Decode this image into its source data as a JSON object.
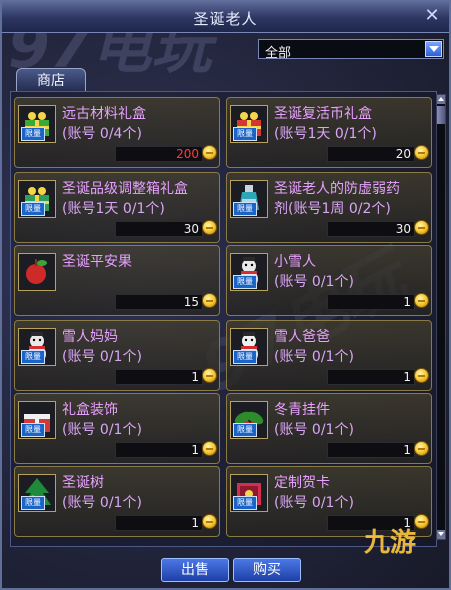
{
  "window": {
    "title": "圣诞老人",
    "close_label": "✕"
  },
  "filter": {
    "selected": "全部"
  },
  "tabs": [
    {
      "label": "商店"
    }
  ],
  "items": [
    {
      "name": "远古材料礼盒",
      "limit": "(账号 0/4个)",
      "price": "200",
      "price_red": true,
      "limited": true,
      "icon": "gift-box-icon",
      "color": "#3aa83a"
    },
    {
      "name": "圣诞复活币礼盒",
      "limit": "(账号1天 0/1个)",
      "price": "20",
      "price_red": false,
      "limited": true,
      "icon": "gift-box-icon",
      "color": "#d23636"
    },
    {
      "name": "圣诞品级调整箱礼盒",
      "limit": "(账号1天 0/1个)",
      "price": "30",
      "price_red": false,
      "limited": true,
      "icon": "gift-box-icon",
      "color": "#2fa05c"
    },
    {
      "name": "圣诞老人的防虚弱药",
      "limit": "剂(账号1周 0/2个)",
      "price": "30",
      "price_red": false,
      "limited": true,
      "icon": "potion-icon",
      "color": "#2fa6b8"
    },
    {
      "name": "圣诞平安果",
      "limit": "",
      "price": "15",
      "price_red": false,
      "limited": false,
      "icon": "apple-icon",
      "color": "#cf2a2a"
    },
    {
      "name": "小雪人",
      "limit": "(账号 0/1个)",
      "price": "1",
      "price_red": false,
      "limited": true,
      "icon": "snowman-icon",
      "color": "#e8e8e8"
    },
    {
      "name": "雪人妈妈",
      "limit": "(账号 0/1个)",
      "price": "1",
      "price_red": false,
      "limited": true,
      "icon": "snowman-icon",
      "color": "#e8e8e8"
    },
    {
      "name": "雪人爸爸",
      "limit": "(账号 0/1个)",
      "price": "1",
      "price_red": false,
      "limited": true,
      "icon": "snowman-icon",
      "color": "#f0f0f0"
    },
    {
      "name": "礼盒装饰",
      "limit": "(账号 0/1个)",
      "price": "1",
      "price_red": false,
      "limited": true,
      "icon": "gift-decoration-icon",
      "color": "#cf3a3a"
    },
    {
      "name": "冬青挂件",
      "limit": "(账号 0/1个)",
      "price": "1",
      "price_red": false,
      "limited": true,
      "icon": "holly-icon",
      "color": "#2c8c2c"
    },
    {
      "name": "圣诞树",
      "limit": "(账号 0/1个)",
      "price": "1",
      "price_red": false,
      "limited": true,
      "icon": "christmas-tree-icon",
      "color": "#1f8a3a"
    },
    {
      "name": "定制贺卡",
      "limit": "(账号 0/1个)",
      "price": "1",
      "price_red": false,
      "limited": true,
      "icon": "greeting-card-icon",
      "color": "#d0304e"
    }
  ],
  "limited_tag": "限量",
  "buttons": {
    "sell": "出售",
    "buy": "购买"
  },
  "watermarks": {
    "top": "97电玩",
    "middle": "97电玩",
    "corner": "九游"
  }
}
